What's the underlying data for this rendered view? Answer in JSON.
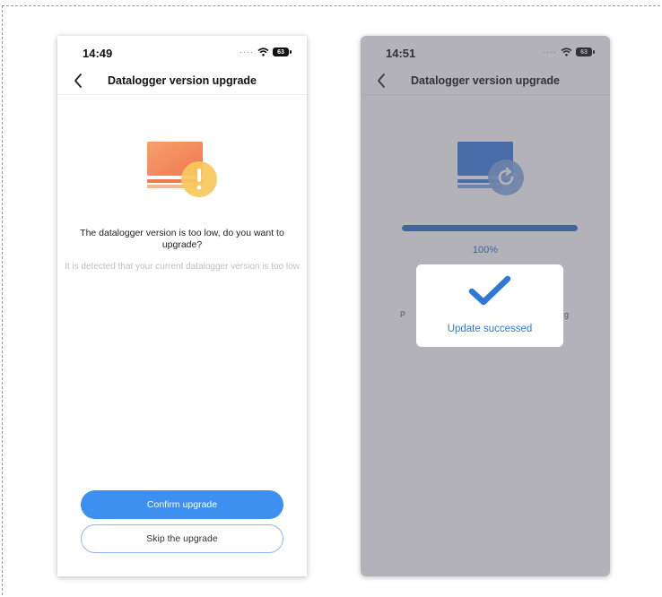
{
  "screens": {
    "before": {
      "status_time": "14:49",
      "battery_label": "63",
      "nav_title": "Datalogger version upgrade",
      "message_title": "The datalogger version is too low, do you want to upgrade?",
      "message_subtitle": "It is detected that your current datalogger version is too low",
      "confirm_label": "Confirm upgrade",
      "skip_label": "Skip the upgrade"
    },
    "after": {
      "status_time": "14:51",
      "battery_label": "63",
      "nav_title": "Datalogger version upgrade",
      "progress_percent": 100,
      "progress_label": "100%",
      "toast_message": "Update successed",
      "partial_letters": [
        "P",
        "g"
      ]
    }
  },
  "colors": {
    "primary": "#3d8ff0",
    "progress": "#2f6fd0",
    "warning_orange": "#f58a5c",
    "warning_yellow": "#f7c95c",
    "success_check": "#2f78d6"
  },
  "icons": {
    "back": "chevron-left-icon",
    "wifi": "wifi-icon",
    "battery": "battery-icon",
    "warning": "warning-icon",
    "refresh": "refresh-icon",
    "check": "check-icon"
  }
}
